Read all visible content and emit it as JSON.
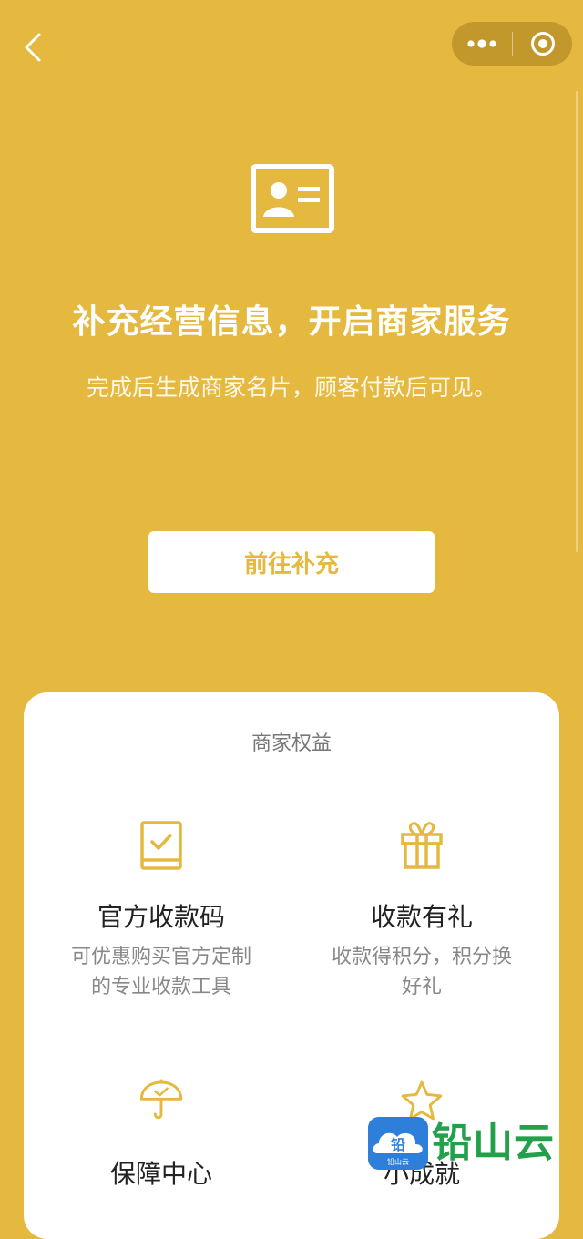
{
  "nav": {
    "back_icon": "chevron-left-icon",
    "more_icon": "more-dots-icon",
    "close_icon": "target-circle-icon"
  },
  "hero": {
    "icon": "id-card-icon",
    "title": "补充经营信息，开启商家服务",
    "subtitle": "完成后生成商家名片，顾客付款后可见。",
    "button_label": "前往补充"
  },
  "benefits": {
    "title": "商家权益",
    "items": [
      {
        "name": "官方收款码",
        "desc": "可优惠购买官方定制的专业收款工具",
        "icon": "qr-book-check-icon"
      },
      {
        "name": "收款有礼",
        "desc": "收款得积分，积分换好礼",
        "icon": "gift-icon"
      },
      {
        "name": "保障中心",
        "desc": "",
        "icon": "umbrella-check-icon"
      },
      {
        "name": "小成就",
        "desc": "",
        "icon": "star-icon"
      }
    ]
  },
  "watermark": {
    "logo_glyph": "铅",
    "logo_caption": "铅山云",
    "text": "铅山云"
  },
  "colors": {
    "background": "#E5B93F",
    "card": "#FFFFFF",
    "accent": "#E5B93F",
    "watermark_green": "#22A04A",
    "watermark_blue": "#2E7FD9"
  }
}
